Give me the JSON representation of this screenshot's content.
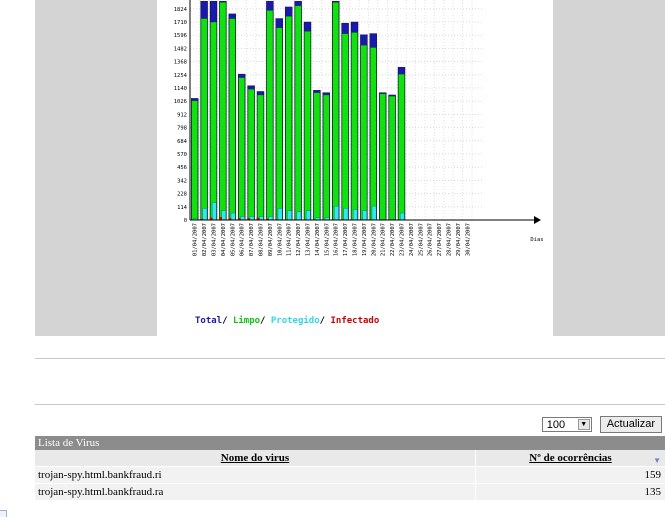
{
  "chart_data": {
    "type": "bar",
    "categories": [
      "01/04/2007",
      "02/04/2007",
      "03/04/2007",
      "04/04/2007",
      "05/04/2007",
      "06/04/2007",
      "07/04/2007",
      "08/04/2007",
      "09/04/2007",
      "10/04/2007",
      "11/04/2007",
      "12/04/2007",
      "13/04/2007",
      "14/04/2007",
      "15/04/2007",
      "16/04/2007",
      "17/04/2007",
      "18/04/2007",
      "19/04/2007",
      "20/04/2007",
      "21/04/2007",
      "22/04/2007",
      "23/04/2007",
      "24/04/2007",
      "25/04/2007",
      "26/04/2007",
      "27/04/2007",
      "28/04/2007",
      "29/04/2007",
      "30/04/2007"
    ],
    "y_ticks": [
      0,
      114,
      228,
      342,
      456,
      570,
      684,
      798,
      912,
      1026,
      1140,
      1254,
      1368,
      1482,
      1596,
      1710,
      1824
    ],
    "x_axis_label": "Dias",
    "series": [
      {
        "name": "Total",
        "color": "#1a1aa8",
        "values": [
          1050,
          1890,
          1890,
          1890,
          1780,
          1260,
          1160,
          1110,
          1890,
          1740,
          1840,
          1890,
          1710,
          1120,
          1100,
          1890,
          1700,
          1710,
          1600,
          1610,
          1100,
          1080,
          1320,
          0,
          0,
          0,
          0,
          0,
          0,
          0
        ]
      },
      {
        "name": "Limpo",
        "color": "#11e011",
        "values": [
          1030,
          1740,
          1710,
          1880,
          1740,
          1230,
          1130,
          1080,
          1810,
          1660,
          1760,
          1850,
          1630,
          1100,
          1080,
          1880,
          1610,
          1620,
          1510,
          1490,
          1090,
          1070,
          1260,
          0,
          0,
          0,
          0,
          0,
          0,
          0
        ]
      },
      {
        "name": "Protegido",
        "color": "#33e6f0",
        "values": [
          10,
          100,
          150,
          80,
          60,
          30,
          30,
          30,
          30,
          100,
          80,
          70,
          80,
          20,
          20,
          120,
          100,
          90,
          80,
          120,
          5,
          5,
          60,
          0,
          0,
          0,
          0,
          0,
          0,
          0
        ]
      },
      {
        "name": "Infectado",
        "color": "#cc0000",
        "values": [
          2,
          10,
          20,
          25,
          15,
          15,
          15,
          20,
          10,
          5,
          5,
          5,
          5,
          3,
          3,
          5,
          5,
          5,
          5,
          5,
          2,
          2,
          3,
          0,
          0,
          0,
          0,
          0,
          0,
          0
        ]
      }
    ]
  },
  "legend": {
    "total": "Total",
    "limpo": "Limpo",
    "protegido": "Protegido",
    "infectado": "Infectado",
    "separator": "/"
  },
  "controls": {
    "page_size": "100",
    "refresh_label": "Actualizar"
  },
  "table": {
    "title": "Lista de Virus",
    "columns": [
      "Nome do virus",
      "Nº de ocorrências"
    ],
    "rows": [
      {
        "name": "trojan-spy.html.bankfraud.ri",
        "count": "159"
      },
      {
        "name": "trojan-spy.html.bankfraud.ra",
        "count": "135"
      }
    ]
  }
}
